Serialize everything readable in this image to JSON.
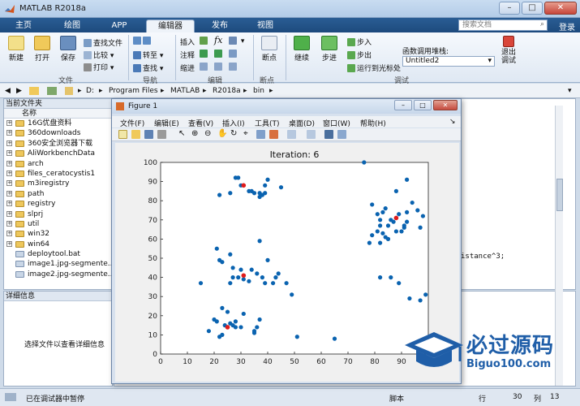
{
  "window": {
    "title": "MATLAB R2018a",
    "min": "–",
    "max": "□",
    "close": "✕"
  },
  "tabs": [
    {
      "label": "主页"
    },
    {
      "label": "绘图"
    },
    {
      "label": "APP"
    },
    {
      "label": "编辑器",
      "active": true
    },
    {
      "label": "发布"
    },
    {
      "label": "视图"
    }
  ],
  "search_placeholder": "搜索文档",
  "login": "登录",
  "ribbon": {
    "file": {
      "new": "新建",
      "open": "打开",
      "save": "保存",
      "find_files": "查找文件",
      "compare": "比较",
      "print": "打印",
      "group": "文件"
    },
    "nav": {
      "goto": "转至",
      "find": "查找",
      "group": "导航"
    },
    "edit": {
      "insert": "插入",
      "comment": "注释",
      "indent": "缩进",
      "fx": "fx",
      "group": "编辑"
    },
    "breakpoints": {
      "bp": "断点",
      "group": "断点"
    },
    "debug": {
      "continue": "继续",
      "step": "步进",
      "step_in": "步入",
      "step_out": "步出",
      "run_to_cursor": "运行到光标处",
      "stack_label": "函数调用堆栈:",
      "stack_value": "Untitled2",
      "quit_debug": "退出\n调试",
      "group": "调试"
    }
  },
  "address": [
    "D:",
    "Program Files",
    "MATLAB",
    "R2018a",
    "bin"
  ],
  "left_panel": {
    "title": "当前文件夹",
    "col_name": "名称",
    "files": [
      {
        "name": "16G优盘资料",
        "type": "folder"
      },
      {
        "name": "360downloads",
        "type": "folder"
      },
      {
        "name": "360安全浏览器下载",
        "type": "folder"
      },
      {
        "name": "AliWorkbenchData",
        "type": "folder"
      },
      {
        "name": "arch",
        "type": "folder"
      },
      {
        "name": "files_ceratocystis1",
        "type": "folder"
      },
      {
        "name": "m3iregistry",
        "type": "folder"
      },
      {
        "name": "path",
        "type": "folder"
      },
      {
        "name": "registry",
        "type": "folder"
      },
      {
        "name": "slprj",
        "type": "folder"
      },
      {
        "name": "util",
        "type": "folder"
      },
      {
        "name": "win32",
        "type": "folder"
      },
      {
        "name": "win64",
        "type": "folder"
      },
      {
        "name": "deploytool.bat",
        "type": "file"
      },
      {
        "name": "image1.jpg-segmente...",
        "type": "file"
      },
      {
        "name": "image2.jpg-segmente...",
        "type": "file"
      }
    ]
  },
  "detail_panel": {
    "title": "详细信息",
    "message": "选择文件以查看详细信息"
  },
  "editor_code": "istance^3;",
  "status": {
    "left": "已在调试器中暂停",
    "mode": "脚本",
    "row_label": "行",
    "row": "30",
    "col_label": "列",
    "col": "13"
  },
  "figure": {
    "title": "Figure 1",
    "menu": [
      "文件(F)",
      "编辑(E)",
      "查看(V)",
      "插入(I)",
      "工具(T)",
      "桌面(D)",
      "窗口(W)",
      "帮助(H)"
    ]
  },
  "watermark": {
    "title": "必过源码",
    "subtitle": "Biguo100.com"
  },
  "colors": {
    "point": "#0a63b0",
    "center": "#e01b1b",
    "accent": "#1f5ea8"
  },
  "chart_data": {
    "type": "scatter",
    "title": "Iteration: 6",
    "xlim": [
      0,
      100
    ],
    "ylim": [
      0,
      100
    ],
    "xticks": [
      0,
      10,
      20,
      30,
      40,
      50,
      60,
      70,
      80,
      90,
      100
    ],
    "yticks": [
      0,
      10,
      20,
      30,
      40,
      50,
      60,
      70,
      80,
      90,
      100
    ],
    "series": [
      {
        "points": [
          [
            76,
            100
          ],
          [
            29,
            92
          ],
          [
            28,
            92
          ],
          [
            40,
            91
          ],
          [
            39,
            88
          ],
          [
            30,
            88
          ],
          [
            33,
            85
          ],
          [
            34,
            85
          ],
          [
            35,
            84
          ],
          [
            37,
            84
          ],
          [
            38,
            83
          ],
          [
            37,
            82
          ],
          [
            26,
            84
          ],
          [
            22,
            83
          ],
          [
            45,
            87
          ],
          [
            39,
            84
          ],
          [
            92,
            91
          ],
          [
            88,
            85
          ],
          [
            94,
            79
          ],
          [
            79,
            78
          ],
          [
            84,
            76
          ],
          [
            92,
            74
          ],
          [
            81,
            73
          ],
          [
            83,
            74
          ],
          [
            89,
            73
          ],
          [
            88,
            71
          ],
          [
            86,
            70
          ],
          [
            82,
            70
          ],
          [
            87,
            69
          ],
          [
            92,
            69
          ],
          [
            91,
            67
          ],
          [
            82,
            67
          ],
          [
            85,
            67
          ],
          [
            81,
            64
          ],
          [
            88,
            64
          ],
          [
            90,
            64
          ],
          [
            83,
            63
          ],
          [
            79,
            62
          ],
          [
            84,
            61
          ],
          [
            85,
            60
          ],
          [
            82,
            58
          ],
          [
            78,
            58
          ],
          [
            96,
            75
          ],
          [
            98,
            72
          ],
          [
            97,
            66
          ],
          [
            91,
            66
          ],
          [
            21,
            55
          ],
          [
            37,
            59
          ],
          [
            26,
            52
          ],
          [
            22,
            49
          ],
          [
            23,
            48
          ],
          [
            40,
            49
          ],
          [
            27,
            45
          ],
          [
            30,
            44
          ],
          [
            34,
            44
          ],
          [
            36,
            42
          ],
          [
            44,
            42
          ],
          [
            27,
            40
          ],
          [
            29,
            40
          ],
          [
            38,
            40
          ],
          [
            43,
            40
          ],
          [
            31,
            39
          ],
          [
            33,
            38
          ],
          [
            26,
            37
          ],
          [
            15,
            37
          ],
          [
            39,
            37
          ],
          [
            42,
            37
          ],
          [
            47,
            37
          ],
          [
            49,
            31
          ],
          [
            82,
            40
          ],
          [
            86,
            40
          ],
          [
            89,
            37
          ],
          [
            93,
            29
          ],
          [
            99,
            31
          ],
          [
            97,
            28
          ],
          [
            23,
            24
          ],
          [
            25,
            22
          ],
          [
            31,
            21
          ],
          [
            20,
            18
          ],
          [
            21,
            17
          ],
          [
            28,
            17
          ],
          [
            26,
            16
          ],
          [
            24,
            15
          ],
          [
            27,
            15
          ],
          [
            28,
            14
          ],
          [
            30,
            14
          ],
          [
            37,
            18
          ],
          [
            36,
            14
          ],
          [
            18,
            12
          ],
          [
            35,
            12
          ],
          [
            35,
            11
          ],
          [
            23,
            10
          ],
          [
            22,
            9
          ],
          [
            51,
            9
          ],
          [
            65,
            8
          ]
        ]
      }
    ],
    "centers": [
      [
        31,
        88
      ],
      [
        88,
        71
      ],
      [
        31,
        41
      ],
      [
        25,
        14
      ]
    ]
  }
}
